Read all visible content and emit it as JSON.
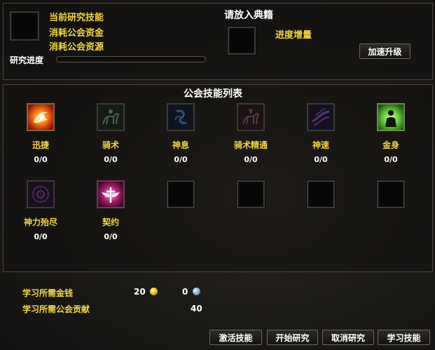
{
  "research": {
    "current_label": "当前研究技能",
    "consume_funds_label": "消耗公会资金",
    "consume_resources_label": "消耗公会资源",
    "progress_label": "研究进度",
    "progress_value": 0
  },
  "book": {
    "title": "请放入典籍",
    "increase_label": "进度增量",
    "speedup_button": "加速升级"
  },
  "skills_panel": {
    "title": "公会技能列表",
    "skills": [
      {
        "name": "迅捷",
        "count": "0/0",
        "icon": "swift-flame-icon"
      },
      {
        "name": "骑术",
        "count": "0/0",
        "icon": "horse-rider-icon"
      },
      {
        "name": "神息",
        "count": "0/0",
        "icon": "divine-breath-icon"
      },
      {
        "name": "骑术精通",
        "count": "0/0",
        "icon": "horse-mastery-icon"
      },
      {
        "name": "神速",
        "count": "0/0",
        "icon": "divine-speed-icon"
      },
      {
        "name": "金身",
        "count": "0/0",
        "icon": "golden-body-icon"
      },
      {
        "name": "神力殆尽",
        "count": "0/0",
        "icon": "power-exhausted-icon"
      },
      {
        "name": "契约",
        "count": "0/0",
        "icon": "winged-pact-icon"
      }
    ]
  },
  "costs": {
    "money_label": "学习所需金钱",
    "gold": "20",
    "silver": "0",
    "contribution_label": "学习所需公会贡献",
    "contribution": "40"
  },
  "buttons": {
    "activate": "激活技能",
    "start": "开始研究",
    "cancel": "取消研究",
    "learn": "学习技能"
  },
  "colors": {
    "accent_gold": "#f0d548",
    "panel_border": "#4a4640"
  }
}
